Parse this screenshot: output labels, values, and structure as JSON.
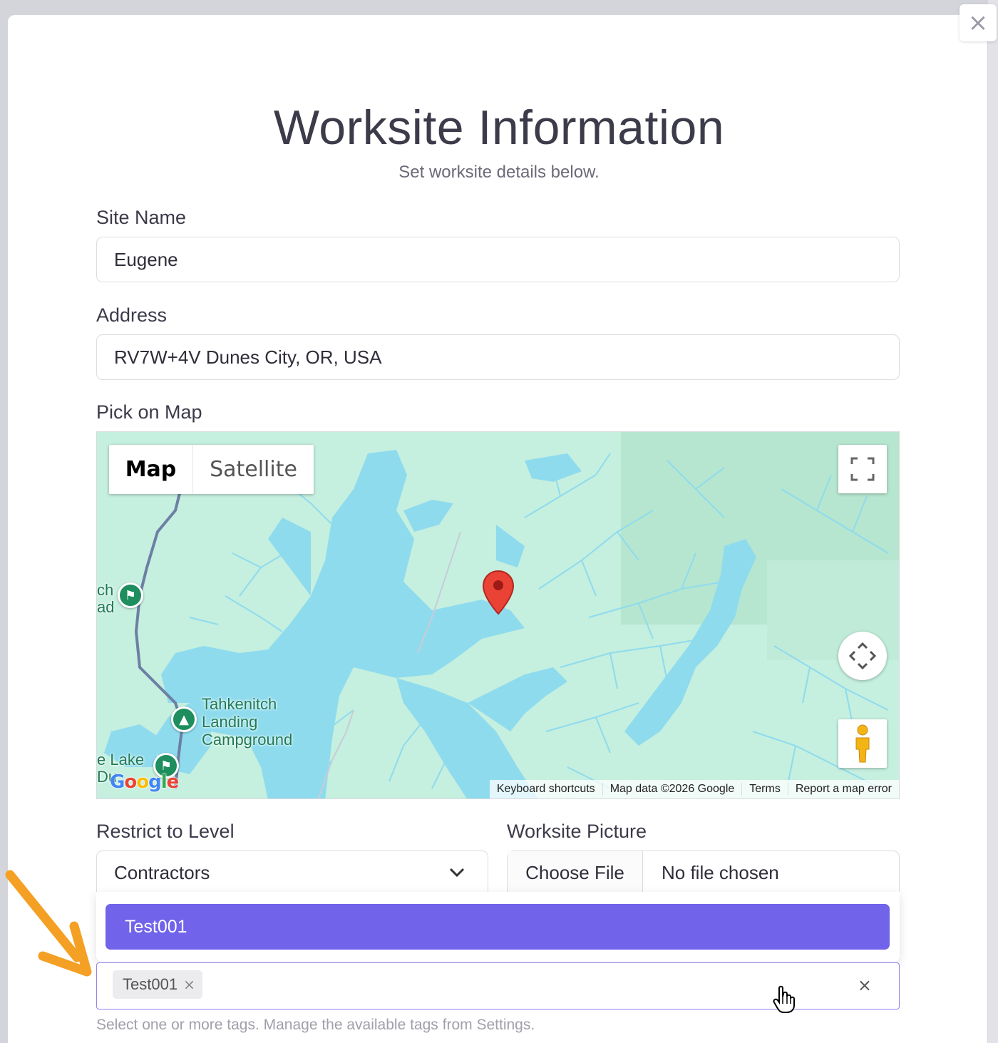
{
  "modal": {
    "title": "Worksite Information",
    "subtitle": "Set worksite details below.",
    "close_icon": "×"
  },
  "site_name": {
    "label": "Site Name",
    "value": "Eugene"
  },
  "address": {
    "label": "Address",
    "value": "RV7W+4V Dunes City, OR, USA"
  },
  "map": {
    "label": "Pick on Map",
    "map_type_map": "Map",
    "map_type_satellite": "Satellite",
    "place_labels": [
      "Tahkenitch",
      "Landing",
      "Campground"
    ],
    "edge_label_1": "ch",
    "edge_label_2": "ad",
    "edge_label_3": "e Lake",
    "edge_label_4": "Du",
    "google_logo": "Google",
    "attribution": {
      "shortcuts": "Keyboard shortcuts",
      "data": "Map data ©2026 Google",
      "terms": "Terms",
      "report": "Report a map error"
    },
    "colors": {
      "land": "#c5efdf",
      "water": "#8fdbee",
      "road": "#6d7fa3"
    }
  },
  "level": {
    "label": "Restrict to Level",
    "selected": "Contractors"
  },
  "picture": {
    "label": "Worksite Picture",
    "button": "Choose File",
    "status": "No file chosen"
  },
  "tags": {
    "dropdown_option": "Test001",
    "selected_chip": "Test001",
    "chip_remove": "×",
    "clear_all": "×",
    "help": "Select one or more tags. Manage the available tags from Settings."
  },
  "accent_color": "#7163ea",
  "annotation_color": "#f4a024"
}
